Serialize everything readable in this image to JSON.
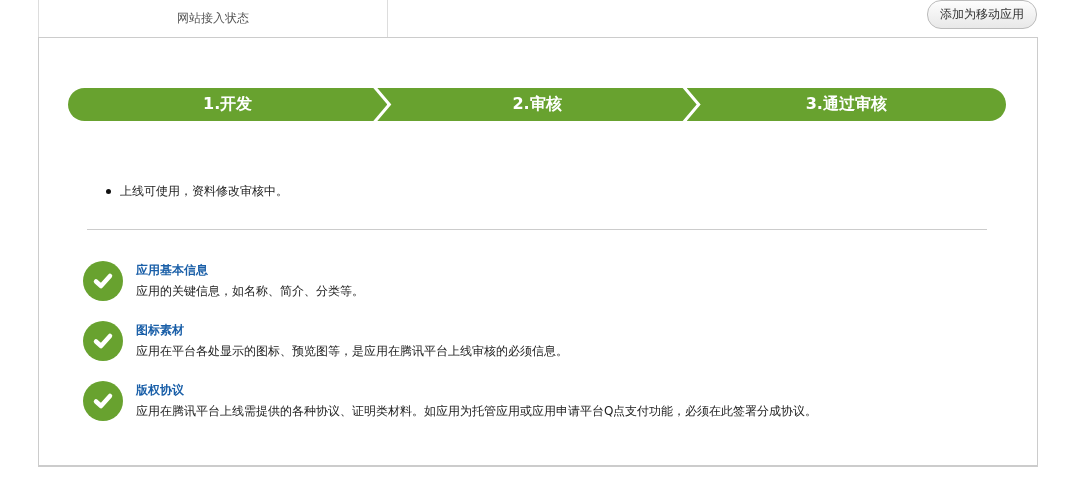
{
  "header": {
    "tab": "网站接入状态",
    "button": "添加为移动应用"
  },
  "steps": [
    {
      "label": "1.开发"
    },
    {
      "label": "2.审核"
    },
    {
      "label": "3.通过审核"
    }
  ],
  "status_notes": [
    "上线可使用，资料修改审核中。"
  ],
  "checklist": [
    {
      "title": "应用基本信息",
      "description": "应用的关键信息，如名称、简介、分类等。",
      "checked": true
    },
    {
      "title": "图标素材",
      "description": "应用在平台各处显示的图标、预览图等，是应用在腾讯平台上线审核的必须信息。",
      "checked": true
    },
    {
      "title": "版权协议",
      "description": "应用在腾讯平台上线需提供的各种协议、证明类材料。如应用为托管应用或应用申请平台Q点支付功能，必须在此签署分成协议。",
      "checked": true
    }
  ]
}
